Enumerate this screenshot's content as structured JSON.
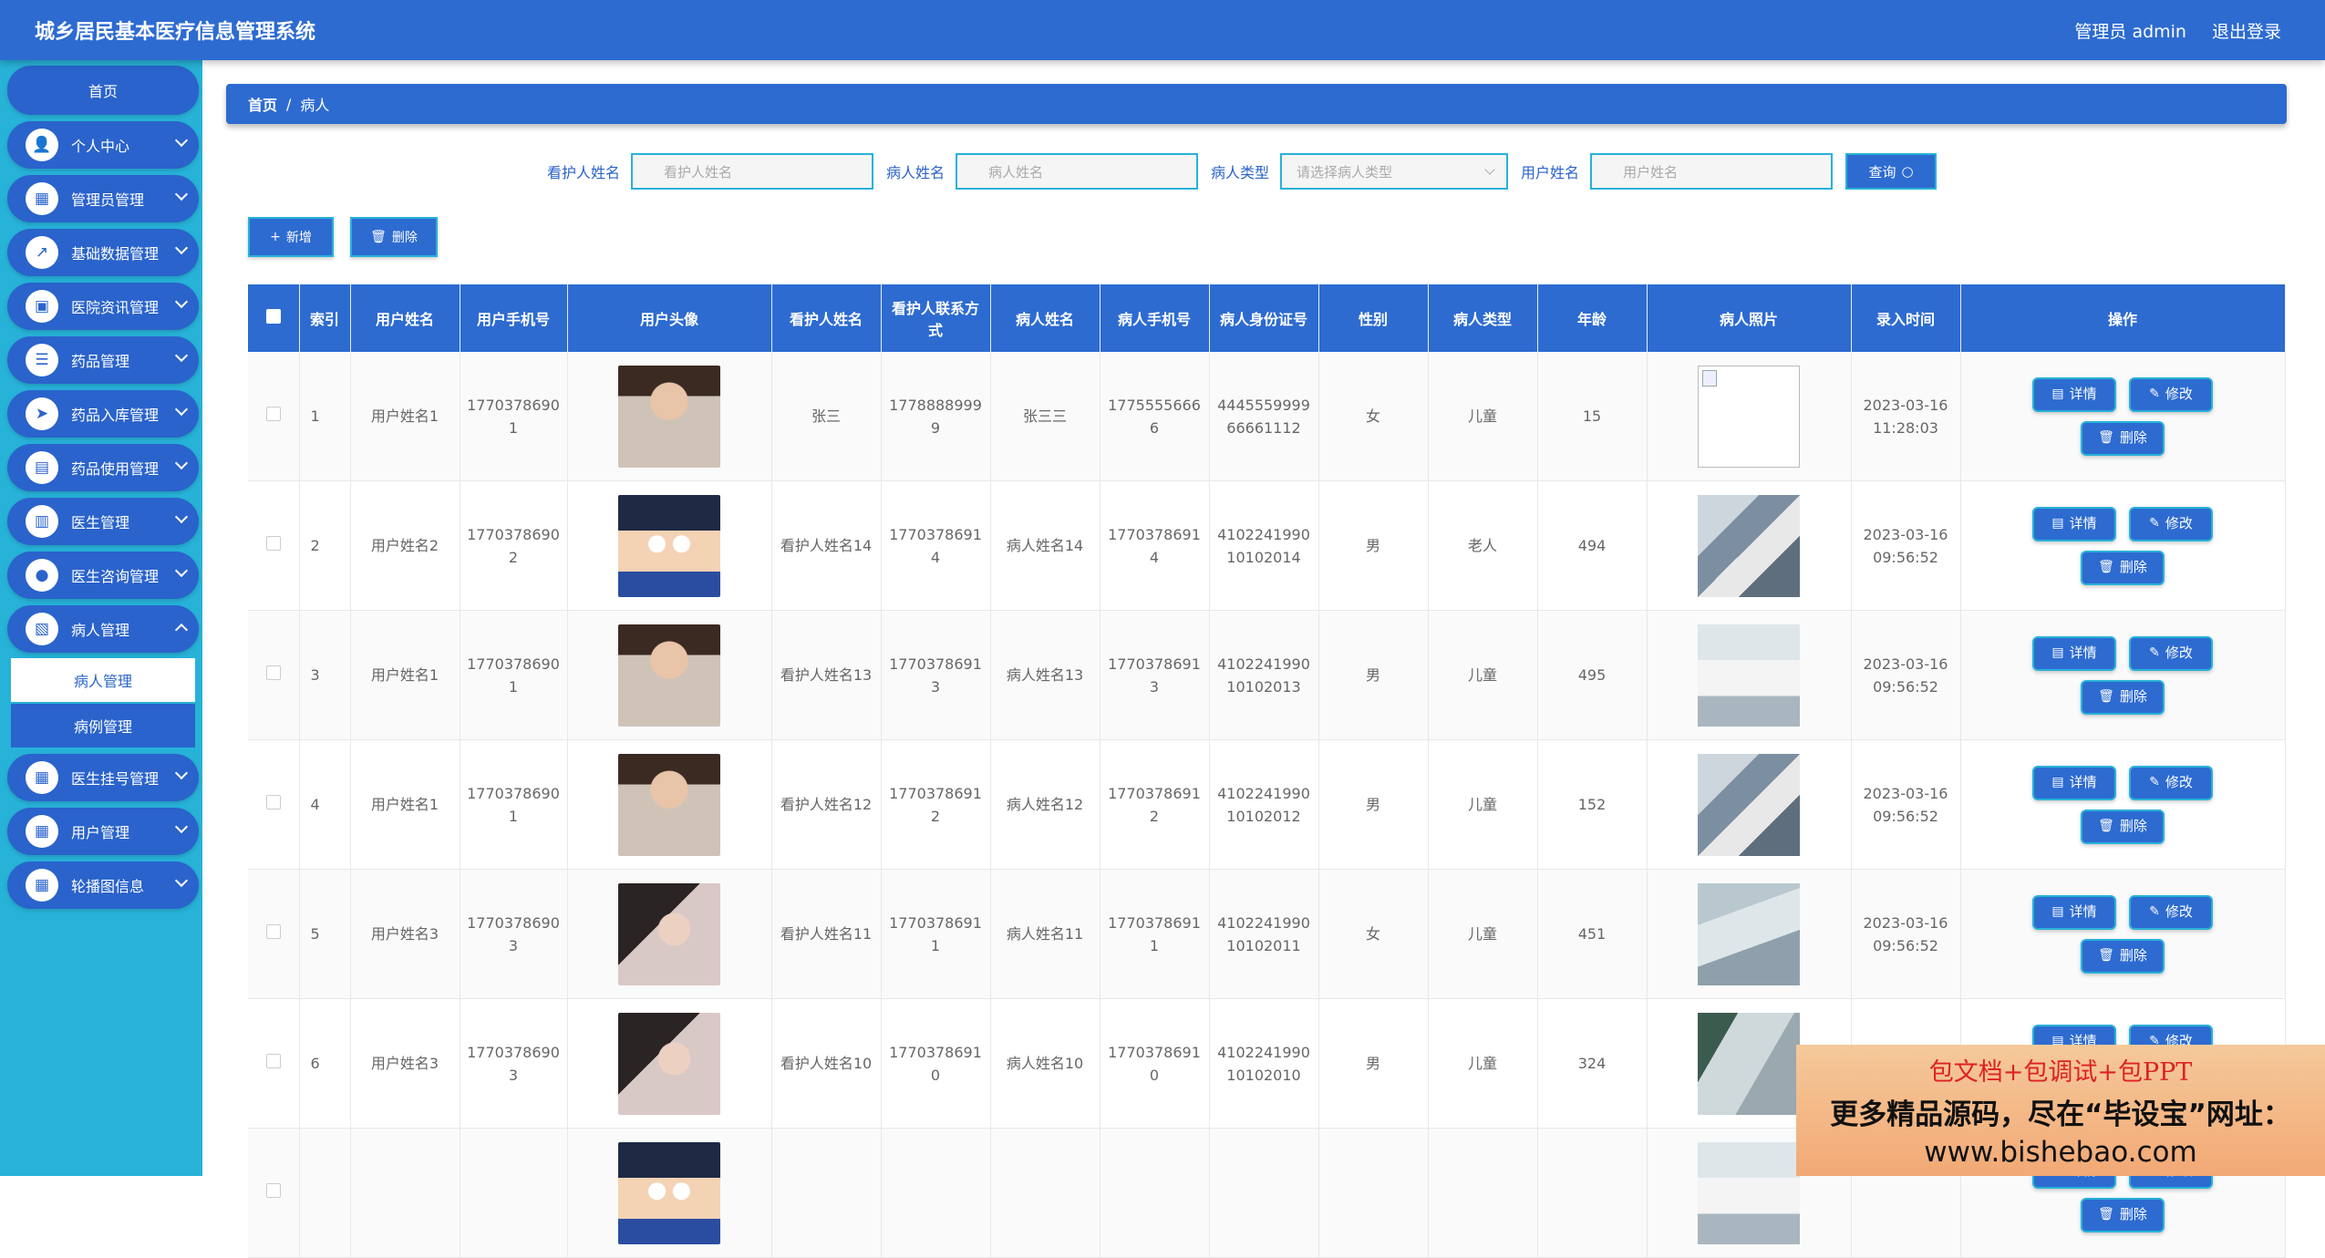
{
  "app": {
    "title": "城乡居民基本医疗信息管理系统",
    "user_label": "管理员 admin",
    "logout_label": "退出登录"
  },
  "sidebar": {
    "home": "首页",
    "items": [
      {
        "label": "个人中心",
        "icon": "👤"
      },
      {
        "label": "管理员管理",
        "icon": "▦"
      },
      {
        "label": "基础数据管理",
        "icon": "↗"
      },
      {
        "label": "医院资讯管理",
        "icon": "▣"
      },
      {
        "label": "药品管理",
        "icon": "☰"
      },
      {
        "label": "药品入库管理",
        "icon": "➤"
      },
      {
        "label": "药品使用管理",
        "icon": "▤"
      },
      {
        "label": "医生管理",
        "icon": "▥"
      },
      {
        "label": "医生咨询管理",
        "icon": "●"
      },
      {
        "label": "病人管理",
        "icon": "▧",
        "sub": [
          "病人管理",
          "病例管理"
        ]
      },
      {
        "label": "医生挂号管理",
        "icon": "▦"
      },
      {
        "label": "用户管理",
        "icon": "▦"
      },
      {
        "label": "轮播图信息",
        "icon": "▦"
      }
    ]
  },
  "breadcrumb": {
    "home": "首页",
    "sep": "/",
    "current": "病人"
  },
  "search": {
    "caregiver_label": "看护人姓名",
    "caregiver_placeholder": "看护人姓名",
    "patient_label": "病人姓名",
    "patient_placeholder": "病人姓名",
    "type_label": "病人类型",
    "type_placeholder": "请选择病人类型",
    "user_label": "用户姓名",
    "user_placeholder": "用户姓名",
    "query_label": "查询"
  },
  "toolbar": {
    "add_label": "新增",
    "delete_label": "删除"
  },
  "table": {
    "headers": [
      "索引",
      "用户姓名",
      "用户手机号",
      "用户头像",
      "看护人姓名",
      "看护人联系方式",
      "病人姓名",
      "病人手机号",
      "病人身份证号",
      "性别",
      "病人类型",
      "年龄",
      "病人照片",
      "录入时间",
      "操作"
    ],
    "rows": [
      {
        "index": "1",
        "user_name": "用户姓名1",
        "user_phone": "17703786901",
        "avatar": "male",
        "caregiver": "张三",
        "caregiver_phone": "17788889999",
        "patient_name": "张三三",
        "patient_phone": "17755556666",
        "id_no": "444555999966661112",
        "gender": "女",
        "type": "儿童",
        "age": "15",
        "photo": "broken",
        "time": "2023-03-16 11:28:03"
      },
      {
        "index": "2",
        "user_name": "用户姓名2",
        "user_phone": "17703786902",
        "avatar": "conan",
        "caregiver": "看护人姓名14",
        "caregiver_phone": "17703786914",
        "patient_name": "病人姓名14",
        "patient_phone": "17703786914",
        "id_no": "410224199010102014",
        "gender": "男",
        "type": "老人",
        "age": "494",
        "photo": "med1",
        "time": "2023-03-16 09:56:52"
      },
      {
        "index": "3",
        "user_name": "用户姓名1",
        "user_phone": "17703786901",
        "avatar": "male",
        "caregiver": "看护人姓名13",
        "caregiver_phone": "17703786913",
        "patient_name": "病人姓名13",
        "patient_phone": "17703786913",
        "id_no": "410224199010102013",
        "gender": "男",
        "type": "儿童",
        "age": "495",
        "photo": "med2",
        "time": "2023-03-16 09:56:52"
      },
      {
        "index": "4",
        "user_name": "用户姓名1",
        "user_phone": "17703786901",
        "avatar": "male",
        "caregiver": "看护人姓名12",
        "caregiver_phone": "17703786912",
        "patient_name": "病人姓名12",
        "patient_phone": "17703786912",
        "id_no": "410224199010102012",
        "gender": "男",
        "type": "儿童",
        "age": "152",
        "photo": "med1",
        "time": "2023-03-16 09:56:52"
      },
      {
        "index": "5",
        "user_name": "用户姓名3",
        "user_phone": "17703786903",
        "avatar": "woman",
        "caregiver": "看护人姓名11",
        "caregiver_phone": "17703786911",
        "patient_name": "病人姓名11",
        "patient_phone": "17703786911",
        "id_no": "410224199010102011",
        "gender": "女",
        "type": "儿童",
        "age": "451",
        "photo": "med3",
        "time": "2023-03-16 09:56:52"
      },
      {
        "index": "6",
        "user_name": "用户姓名3",
        "user_phone": "17703786903",
        "avatar": "woman",
        "caregiver": "看护人姓名10",
        "caregiver_phone": "17703786910",
        "patient_name": "病人姓名10",
        "patient_phone": "17703786910",
        "id_no": "410224199010102010",
        "gender": "男",
        "type": "儿童",
        "age": "324",
        "photo": "med4",
        "time": ""
      },
      {
        "index": "",
        "user_name": "",
        "user_phone": "",
        "avatar": "conan",
        "caregiver": "",
        "caregiver_phone": "",
        "patient_name": "",
        "patient_phone": "",
        "id_no": "",
        "gender": "",
        "type": "",
        "age": "",
        "photo": "med2",
        "time": ""
      }
    ],
    "ops": {
      "detail": "详情",
      "edit": "修改",
      "delete": "删除"
    }
  },
  "ad": {
    "line1": "包文档+包调试+包PPT",
    "line2": "更多精品源码，尽在“毕设宝”网址：",
    "line3": "www.bishebao.com"
  }
}
